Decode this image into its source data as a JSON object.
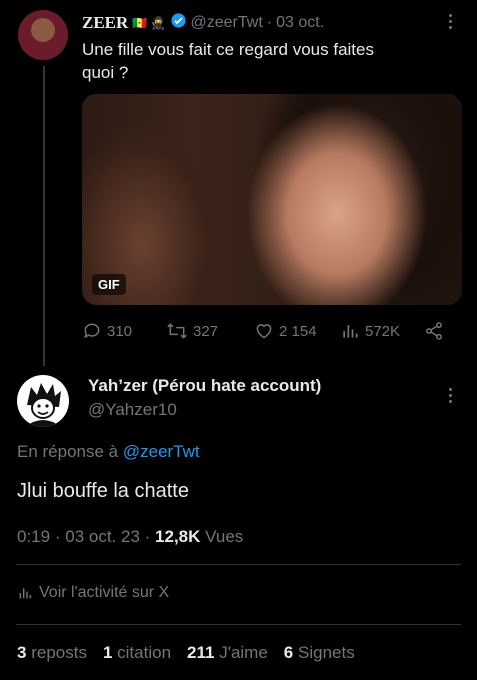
{
  "parent_tweet": {
    "display_name": "ZEER",
    "name_emojis": "🇸🇳 🥷",
    "handle": "@zeerTwt",
    "separator": "·",
    "date": "03 oct.",
    "text": "Une fille vous fait ce regard vous faites quoi ?",
    "gif_label": "GIF",
    "stats": {
      "replies": "310",
      "reposts": "327",
      "likes": "2 154",
      "views": "572K"
    }
  },
  "reply_tweet": {
    "display_name": "Yah’zer (Pérou hate account)",
    "handle": "@Yahzer10",
    "in_reply_prefix": "En réponse à",
    "in_reply_handle": "@zeerTwt",
    "text": "Jlui bouffe la chatte",
    "time": "0:19",
    "sep1": "·",
    "date": "03 oct. 23",
    "sep2": "·",
    "views_count": "12,8K",
    "views_label": "Vues",
    "activity_link": "Voir l'activité sur X",
    "engagement": {
      "reposts_count": "3",
      "reposts_label": "reposts",
      "quotes_count": "1",
      "quotes_label": "citation",
      "likes_count": "211",
      "likes_label": "J'aime",
      "bookmarks_count": "6",
      "bookmarks_label": "Signets"
    }
  },
  "colors": {
    "accent": "#1d9bf0",
    "muted": "#71767b",
    "background": "#000000"
  }
}
